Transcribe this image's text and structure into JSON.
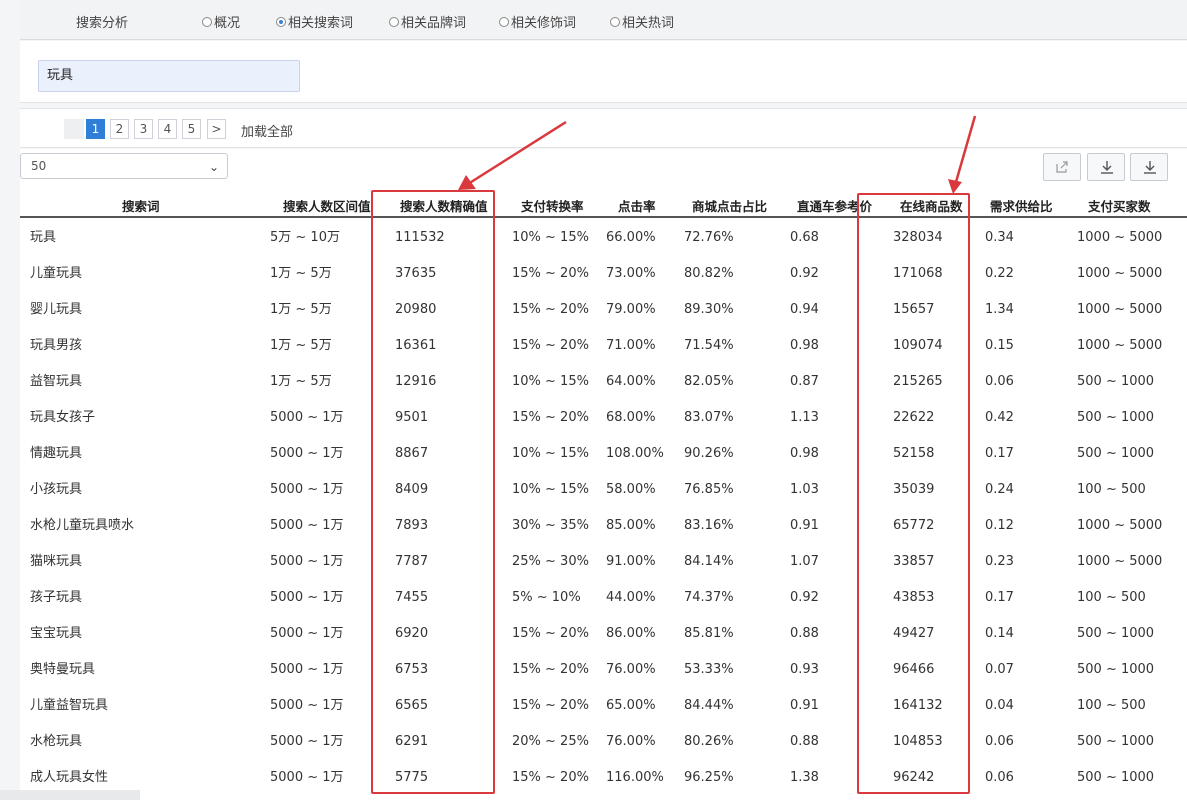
{
  "filter_bar": {
    "label": "搜索分析",
    "options": [
      {
        "label": "概况",
        "checked": false
      },
      {
        "label": "相关搜索词",
        "checked": true
      },
      {
        "label": "相关品牌词",
        "checked": false
      },
      {
        "label": "相关修饰词",
        "checked": false
      },
      {
        "label": "相关热词",
        "checked": false
      }
    ]
  },
  "search": {
    "value": "玩具"
  },
  "pagination": {
    "pages": [
      "1",
      "2",
      "3",
      "4",
      "5"
    ],
    "current": "1",
    "next": ">",
    "load_all": "加载全部"
  },
  "page_size": {
    "selected": "50"
  },
  "toolbar": {
    "icons": [
      "share-icon",
      "download-icon",
      "download-all-icon"
    ]
  },
  "table": {
    "headers": [
      "搜索词",
      "搜索人数区间值",
      "搜索人数精确值",
      "支付转换率",
      "点击率",
      "商城点击占比",
      "直通车参考价",
      "在线商品数",
      "需求供给比",
      "支付买家数"
    ],
    "rows": [
      [
        "玩具",
        "5万 ~ 10万",
        "111532",
        "10% ~ 15%",
        "66.00%",
        "72.76%",
        "0.68",
        "328034",
        "0.34",
        "1000 ~ 5000"
      ],
      [
        "儿童玩具",
        "1万 ~ 5万",
        "37635",
        "15% ~ 20%",
        "73.00%",
        "80.82%",
        "0.92",
        "171068",
        "0.22",
        "1000 ~ 5000"
      ],
      [
        "婴儿玩具",
        "1万 ~ 5万",
        "20980",
        "15% ~ 20%",
        "79.00%",
        "89.30%",
        "0.94",
        "15657",
        "1.34",
        "1000 ~ 5000"
      ],
      [
        "玩具男孩",
        "1万 ~ 5万",
        "16361",
        "15% ~ 20%",
        "71.00%",
        "71.54%",
        "0.98",
        "109074",
        "0.15",
        "1000 ~ 5000"
      ],
      [
        "益智玩具",
        "1万 ~ 5万",
        "12916",
        "10% ~ 15%",
        "64.00%",
        "82.05%",
        "0.87",
        "215265",
        "0.06",
        "500 ~ 1000"
      ],
      [
        "玩具女孩子",
        "5000 ~ 1万",
        "9501",
        "15% ~ 20%",
        "68.00%",
        "83.07%",
        "1.13",
        "22622",
        "0.42",
        "500 ~ 1000"
      ],
      [
        "情趣玩具",
        "5000 ~ 1万",
        "8867",
        "10% ~ 15%",
        "108.00%",
        "90.26%",
        "0.98",
        "52158",
        "0.17",
        "500 ~ 1000"
      ],
      [
        "小孩玩具",
        "5000 ~ 1万",
        "8409",
        "10% ~ 15%",
        "58.00%",
        "76.85%",
        "1.03",
        "35039",
        "0.24",
        "100 ~ 500"
      ],
      [
        "水枪儿童玩具喷水",
        "5000 ~ 1万",
        "7893",
        "30% ~ 35%",
        "85.00%",
        "83.16%",
        "0.91",
        "65772",
        "0.12",
        "1000 ~ 5000"
      ],
      [
        "猫咪玩具",
        "5000 ~ 1万",
        "7787",
        "25% ~ 30%",
        "91.00%",
        "84.14%",
        "1.07",
        "33857",
        "0.23",
        "1000 ~ 5000"
      ],
      [
        "孩子玩具",
        "5000 ~ 1万",
        "7455",
        "5% ~ 10%",
        "44.00%",
        "74.37%",
        "0.92",
        "43853",
        "0.17",
        "100 ~ 500"
      ],
      [
        "宝宝玩具",
        "5000 ~ 1万",
        "6920",
        "15% ~ 20%",
        "86.00%",
        "85.81%",
        "0.88",
        "49427",
        "0.14",
        "500 ~ 1000"
      ],
      [
        "奥特曼玩具",
        "5000 ~ 1万",
        "6753",
        "15% ~ 20%",
        "76.00%",
        "53.33%",
        "0.93",
        "96466",
        "0.07",
        "500 ~ 1000"
      ],
      [
        "儿童益智玩具",
        "5000 ~ 1万",
        "6565",
        "15% ~ 20%",
        "65.00%",
        "84.44%",
        "0.91",
        "164132",
        "0.04",
        "100 ~ 500"
      ],
      [
        "水枪玩具",
        "5000 ~ 1万",
        "6291",
        "20% ~ 25%",
        "76.00%",
        "80.26%",
        "0.88",
        "104853",
        "0.06",
        "500 ~ 1000"
      ],
      [
        "成人玩具女性",
        "5000 ~ 1万",
        "5775",
        "15% ~ 20%",
        "116.00%",
        "96.25%",
        "1.38",
        "96242",
        "0.06",
        "500 ~ 1000"
      ]
    ]
  },
  "annotation_color": "#d9393c",
  "accent_color": "#2f7fd8"
}
